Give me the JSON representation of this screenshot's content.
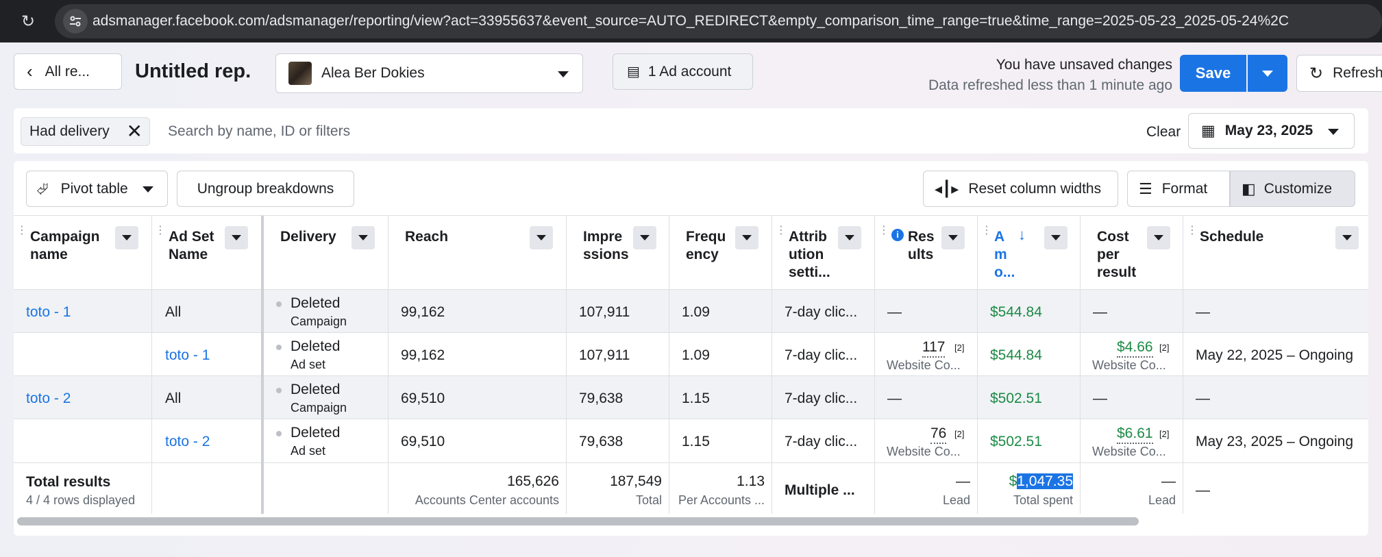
{
  "browser": {
    "url": "adsmanager.facebook.com/adsmanager/reporting/view?act=33955637&event_source=AUTO_REDIRECT&empty_comparison_time_range=true&time_range=2025-05-23_2025-05-24%2C"
  },
  "header": {
    "back_label": "All re...",
    "report_title": "Untitled rep.",
    "account_name": "Alea Ber Dokies",
    "ad_account_label": "1 Ad account",
    "unsaved_text": "You have unsaved changes",
    "refreshed_text": "Data refreshed less than 1 minute ago",
    "save_label": "Save",
    "refresh_label": "Refresh"
  },
  "filters": {
    "chip_label": "Had delivery",
    "search_placeholder": "Search by name, ID or filters",
    "clear_label": "Clear",
    "date_label": "May 23, 2025"
  },
  "toolbar": {
    "pivot_label": "Pivot table",
    "ungroup_label": "Ungroup breakdowns",
    "reset_widths_label": "Reset column widths",
    "format_label": "Format",
    "customize_label": "Customize"
  },
  "table": {
    "headers": {
      "campaign": [
        "Campaign",
        "name"
      ],
      "adset": [
        "Ad Set",
        "Name"
      ],
      "delivery": "Delivery",
      "reach": "Reach",
      "impressions": [
        "Impre",
        "ssions"
      ],
      "frequency": [
        "Frequ",
        "ency"
      ],
      "attribution": [
        "Attrib",
        "ution",
        "setti..."
      ],
      "results": [
        "Res",
        "ults"
      ],
      "amount": [
        "A",
        "m",
        "o..."
      ],
      "cost": [
        "Cost",
        "per",
        "result"
      ],
      "schedule": "Schedule"
    },
    "rows": [
      {
        "campaign": "toto - 1",
        "adset": "All",
        "status": "Deleted",
        "level": "Campaign",
        "reach": "99,162",
        "impressions": "107,911",
        "frequency": "1.09",
        "attribution": "7-day clic...",
        "results": "—",
        "results_sup": "",
        "results_sub": "",
        "amount": "$544.84",
        "cost": "—",
        "cost_sup": "",
        "cost_sub": "",
        "schedule": "—"
      },
      {
        "campaign": "",
        "adset": "toto - 1",
        "status": "Deleted",
        "level": "Ad set",
        "reach": "99,162",
        "impressions": "107,911",
        "frequency": "1.09",
        "attribution": "7-day clic...",
        "results": "117",
        "results_sup": "[2]",
        "results_sub": "Website Co...",
        "amount": "$544.84",
        "cost": "$4.66",
        "cost_sup": "[2]",
        "cost_sub": "Website Co...",
        "schedule": "May 22, 2025 – Ongoing"
      },
      {
        "campaign": "toto - 2",
        "adset": "All",
        "status": "Deleted",
        "level": "Campaign",
        "reach": "69,510",
        "impressions": "79,638",
        "frequency": "1.15",
        "attribution": "7-day clic...",
        "results": "—",
        "results_sup": "",
        "results_sub": "",
        "amount": "$502.51",
        "cost": "—",
        "cost_sup": "",
        "cost_sub": "",
        "schedule": "—"
      },
      {
        "campaign": "",
        "adset": "toto - 2",
        "status": "Deleted",
        "level": "Ad set",
        "reach": "69,510",
        "impressions": "79,638",
        "frequency": "1.15",
        "attribution": "7-day clic...",
        "results": "76",
        "results_sup": "[2]",
        "results_sub": "Website Co...",
        "amount": "$502.51",
        "cost": "$6.61",
        "cost_sup": "[2]",
        "cost_sub": "Website Co...",
        "schedule": "May 23, 2025 – Ongoing"
      }
    ],
    "totals": {
      "label": "Total results",
      "rows_displayed": "4 / 4 rows displayed",
      "reach": "165,626",
      "reach_sub": "Accounts Center accounts",
      "impressions": "187,549",
      "impressions_sub": "Total",
      "frequency": "1.13",
      "frequency_sub": "Per Accounts ...",
      "attribution": "Multiple ...",
      "results": "—",
      "results_sub": "Lead",
      "amount_prefix": "$",
      "amount_selected": "1,047.35",
      "amount_sub": "Total spent",
      "cost": "—",
      "cost_sub": "Lead",
      "schedule": "—"
    }
  },
  "colors": {
    "accent": "#1b74e4",
    "money": "#1b8a45",
    "browser_bar": "#202124"
  }
}
